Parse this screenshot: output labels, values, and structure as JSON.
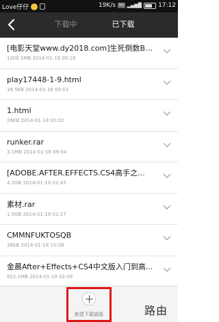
{
  "status_bar": {
    "carrier": "Love仔仔",
    "speed": "19K/s",
    "network": "3G",
    "time": "17:12"
  },
  "header": {
    "back_icon": "chevron-left-icon",
    "tabs": [
      {
        "label": "下载中",
        "active": false
      },
      {
        "label": "已下载",
        "active": true
      }
    ],
    "accent_color": "#e7a400"
  },
  "downloads": [
    {
      "title": "[电影天堂www.dy2018.com]生死倒数BD...",
      "meta": "1006.5MB 2014-01-18 00:16"
    },
    {
      "title": "play17448-1-9.html",
      "meta": "16.5KB 2014-01-18 00:01"
    },
    {
      "title": "1.html",
      "meta": "26KB 2014-01-18 00:02"
    },
    {
      "title": "runker.rar",
      "meta": "3.1MB 2014-01-18 09:04"
    },
    {
      "title": "[ADOBE.AFTER.EFFECTS.CS4高手之...",
      "meta": "4.2GB 2014-01-19 01:45"
    },
    {
      "title": "素材.rar",
      "meta": "1.5GB 2014-01-19 02:27"
    },
    {
      "title": "CMMNFUKTOSQB",
      "meta": "36KB 2014-01-18 10:38"
    },
    {
      "title": "金晨After+Effects+CS4中文版入门到高...",
      "meta": "622.1MB 2014-01-19 02:08"
    }
  ],
  "bottom_bar": {
    "new_download_label": "新建下载链接",
    "highlight_color": "#e11515"
  },
  "watermark": "路由网"
}
